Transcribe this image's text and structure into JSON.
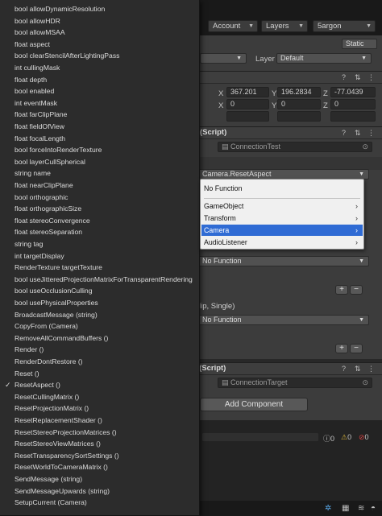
{
  "toolbar": {
    "account": "Account",
    "layers": "Layers",
    "layout": "5argon",
    "static_label": "Static"
  },
  "gameobject": {
    "layer_label": "Layer",
    "layer_value": "Default"
  },
  "transform": {
    "x_label": "X",
    "y_label": "Y",
    "z_label": "Z",
    "pos_x": "367.201",
    "pos_y": "196.2834",
    "pos_z": "-77.0439",
    "rot_x": "0",
    "rot_y": "0",
    "rot_z": "0"
  },
  "connection_test": {
    "header": "(Script)",
    "script_field": "ConnectionTest",
    "event_function": "Camera.ResetAspect",
    "no_function_1": "No Function",
    "param_header": "lip, Single)",
    "no_function_2": "No Function",
    "plus": "+",
    "minus": "−"
  },
  "connection_target": {
    "header": "et (Script)",
    "script_field": "ConnectionTarget",
    "add_component": "Add Component"
  },
  "console": {
    "count_0a": "0",
    "count_0b": "0",
    "count_0c": "0"
  },
  "submenu": {
    "items": [
      "No Function",
      "GameObject",
      "Transform",
      "Camera",
      "AudioListener"
    ],
    "selected": "Camera",
    "selected_color": "#2f6bd4"
  },
  "menu": {
    "checked_item": "ResetAspect ()",
    "items": [
      "bool allowDynamicResolution",
      "bool allowHDR",
      "bool allowMSAA",
      "float aspect",
      "bool clearStencilAfterLightingPass",
      "int cullingMask",
      "float depth",
      "bool enabled",
      "int eventMask",
      "float farClipPlane",
      "float fieldOfView",
      "float focalLength",
      "bool forceIntoRenderTexture",
      "bool layerCullSpherical",
      "string name",
      "float nearClipPlane",
      "bool orthographic",
      "float orthographicSize",
      "float stereoConvergence",
      "float stereoSeparation",
      "string tag",
      "int targetDisplay",
      "RenderTexture targetTexture",
      "bool useJitteredProjectionMatrixForTransparentRendering",
      "bool useOcclusionCulling",
      "bool usePhysicalProperties",
      "BroadcastMessage (string)",
      "CopyFrom (Camera)",
      "RemoveAllCommandBuffers ()",
      "Render ()",
      "RenderDontRestore ()",
      "Reset ()",
      "ResetAspect ()",
      "ResetCullingMatrix ()",
      "ResetProjectionMatrix ()",
      "ResetReplacementShader ()",
      "ResetStereoProjectionMatrices ()",
      "ResetStereoViewMatrices ()",
      "ResetTransparencySortSettings ()",
      "ResetWorldToCameraMatrix ()",
      "SendMessage (string)",
      "SendMessageUpwards (string)",
      "SetupCurrent (Camera)"
    ]
  }
}
